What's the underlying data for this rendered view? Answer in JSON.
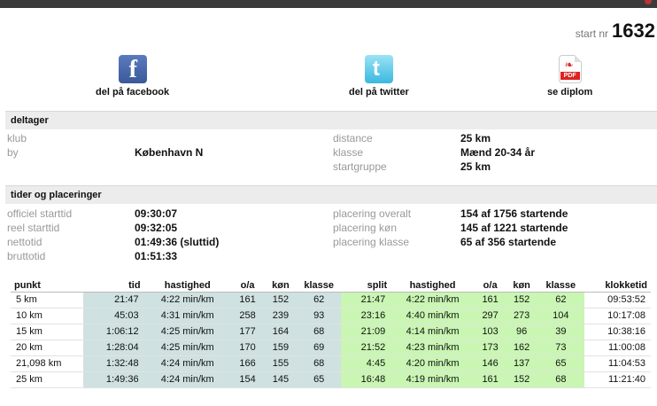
{
  "start": {
    "label": "start nr",
    "number": "1632"
  },
  "share": {
    "facebook": "del på facebook",
    "twitter": "del på twitter",
    "diploma": "se diplom",
    "pdf_label": "PDF"
  },
  "deltager": {
    "title": "deltager",
    "left": [
      {
        "key": "klub",
        "value": ""
      },
      {
        "key": "by",
        "value": "København N"
      }
    ],
    "right": [
      {
        "key": "distance",
        "value": "25 km"
      },
      {
        "key": "klasse",
        "value": "Mænd 20-34 år"
      },
      {
        "key": "startgruppe",
        "value": "25 km"
      }
    ]
  },
  "tider": {
    "title": "tider og placeringer",
    "left": [
      {
        "key": "officiel starttid",
        "value": "09:30:07"
      },
      {
        "key": "reel starttid",
        "value": "09:32:05"
      },
      {
        "key": "nettotid",
        "value": "01:49:36 (sluttid)"
      },
      {
        "key": "bruttotid",
        "value": "01:51:33"
      }
    ],
    "right": [
      {
        "key": "placering overalt",
        "value": "154 af 1756 startende"
      },
      {
        "key": "placering køn",
        "value": "145 af 1221 startende"
      },
      {
        "key": "placering klasse",
        "value": "65 af 356 startende"
      }
    ]
  },
  "table": {
    "headers": [
      "punkt",
      "tid",
      "hastighed",
      "o/a",
      "køn",
      "klasse",
      "split",
      "hastighed",
      "o/a",
      "køn",
      "klasse",
      "klokketid"
    ],
    "rows": [
      [
        "5 km",
        "21:47",
        "4:22 min/km",
        "161",
        "152",
        "62",
        "21:47",
        "4:22 min/km",
        "161",
        "152",
        "62",
        "09:53:52"
      ],
      [
        "10 km",
        "45:03",
        "4:31 min/km",
        "258",
        "239",
        "93",
        "23:16",
        "4:40 min/km",
        "297",
        "273",
        "104",
        "10:17:08"
      ],
      [
        "15 km",
        "1:06:12",
        "4:25 min/km",
        "177",
        "164",
        "68",
        "21:09",
        "4:14 min/km",
        "103",
        "96",
        "39",
        "10:38:16"
      ],
      [
        "20 km",
        "1:28:04",
        "4:25 min/km",
        "170",
        "159",
        "69",
        "21:52",
        "4:23 min/km",
        "173",
        "162",
        "73",
        "11:00:08"
      ],
      [
        "21,098 km",
        "1:32:48",
        "4:24 min/km",
        "166",
        "155",
        "68",
        "4:45",
        "4:20 min/km",
        "146",
        "137",
        "65",
        "11:04:53"
      ],
      [
        "25 km",
        "1:49:36",
        "4:24 min/km",
        "154",
        "145",
        "65",
        "16:48",
        "4:19 min/km",
        "161",
        "152",
        "68",
        "11:21:40"
      ]
    ]
  }
}
